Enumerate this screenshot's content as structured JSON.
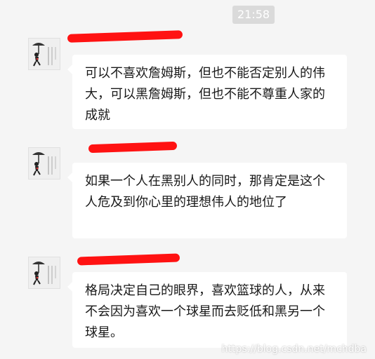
{
  "timestamp": "21:58",
  "messages": [
    {
      "sender": "",
      "text": "可以不喜欢詹姆斯，但也不能否定别人的伟大，可以黑詹姆斯，但也不能不尊重人家的成就"
    },
    {
      "sender": "",
      "text": "如果一个人在黑别人的同时，那肯定是这个人危及到你心里的理想伟人的地位了"
    },
    {
      "sender": "",
      "text": "格局决定自己的眼界，喜欢篮球的人，从来不会因为喜欢一个球星而去贬低和黑另一个球星。"
    }
  ],
  "watermark": "https://blog.csdn.net/mchdba",
  "colors": {
    "background": "#f5f5f5",
    "bubble": "#ffffff",
    "redaction": "#ff1212",
    "time_badge": "#dadada"
  },
  "icons": {
    "avatar": "umbrella-man-avatar-icon"
  }
}
